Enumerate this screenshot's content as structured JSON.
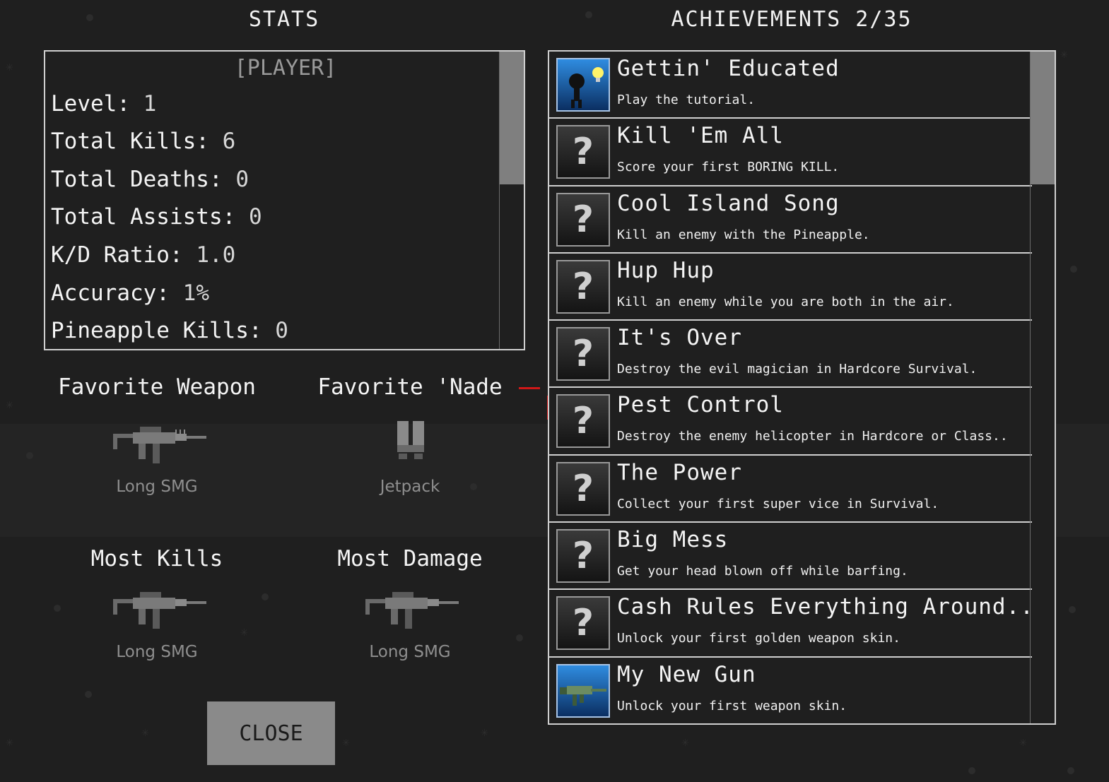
{
  "stats": {
    "heading": "STATS",
    "player_name": "[PLAYER]",
    "lines": [
      {
        "label": "Level:",
        "value": "1"
      },
      {
        "label": "Total Kills:",
        "value": "6"
      },
      {
        "label": "Total Deaths:",
        "value": "0"
      },
      {
        "label": "Total Assists:",
        "value": "0"
      },
      {
        "label": "K/D Ratio:",
        "value": "1.0"
      },
      {
        "label": "Accuracy:",
        "value": "1%"
      },
      {
        "label": "Pineapple Kills:",
        "value": "0"
      }
    ]
  },
  "favorites": {
    "weapon": {
      "title": "Favorite Weapon",
      "name": "Long SMG"
    },
    "nade": {
      "title": "Favorite 'Nade",
      "name": "Jetpack"
    },
    "most_kills": {
      "title": "Most Kills",
      "name": "Long SMG"
    },
    "most_damage": {
      "title": "Most Damage",
      "name": "Long SMG"
    }
  },
  "close_label": "CLOSE",
  "achievements": {
    "heading": "ACHIEVEMENTS 2/35",
    "items": [
      {
        "title": "Gettin' Educated",
        "desc": "Play the tutorial.",
        "unlocked": true,
        "icon": "stickman-lightbulb-icon"
      },
      {
        "title": "Kill 'Em All",
        "desc": "Score your first BORING KILL.",
        "unlocked": false,
        "icon": "question-mark-icon"
      },
      {
        "title": "Cool Island Song",
        "desc": "Kill an enemy with the Pineapple.",
        "unlocked": false,
        "icon": "question-mark-icon"
      },
      {
        "title": "Hup Hup",
        "desc": "Kill an enemy while you are both in the air.",
        "unlocked": false,
        "icon": "question-mark-icon"
      },
      {
        "title": "It's Over",
        "desc": "Destroy the evil magician in Hardcore Survival.",
        "unlocked": false,
        "icon": "question-mark-icon"
      },
      {
        "title": "Pest Control",
        "desc": "Destroy the enemy helicopter in Hardcore or Class..",
        "unlocked": false,
        "icon": "question-mark-icon"
      },
      {
        "title": "The Power",
        "desc": "Collect your first super vice in Survival.",
        "unlocked": false,
        "icon": "question-mark-icon"
      },
      {
        "title": "Big Mess",
        "desc": "Get your head blown off while barfing.",
        "unlocked": false,
        "icon": "question-mark-icon"
      },
      {
        "title": "Cash Rules Everything Around..",
        "desc": "Unlock your first golden weapon skin.",
        "unlocked": false,
        "icon": "question-mark-icon"
      },
      {
        "title": "My New Gun",
        "desc": "Unlock your first weapon skin.",
        "unlocked": true,
        "icon": "rifle-icon"
      }
    ]
  }
}
